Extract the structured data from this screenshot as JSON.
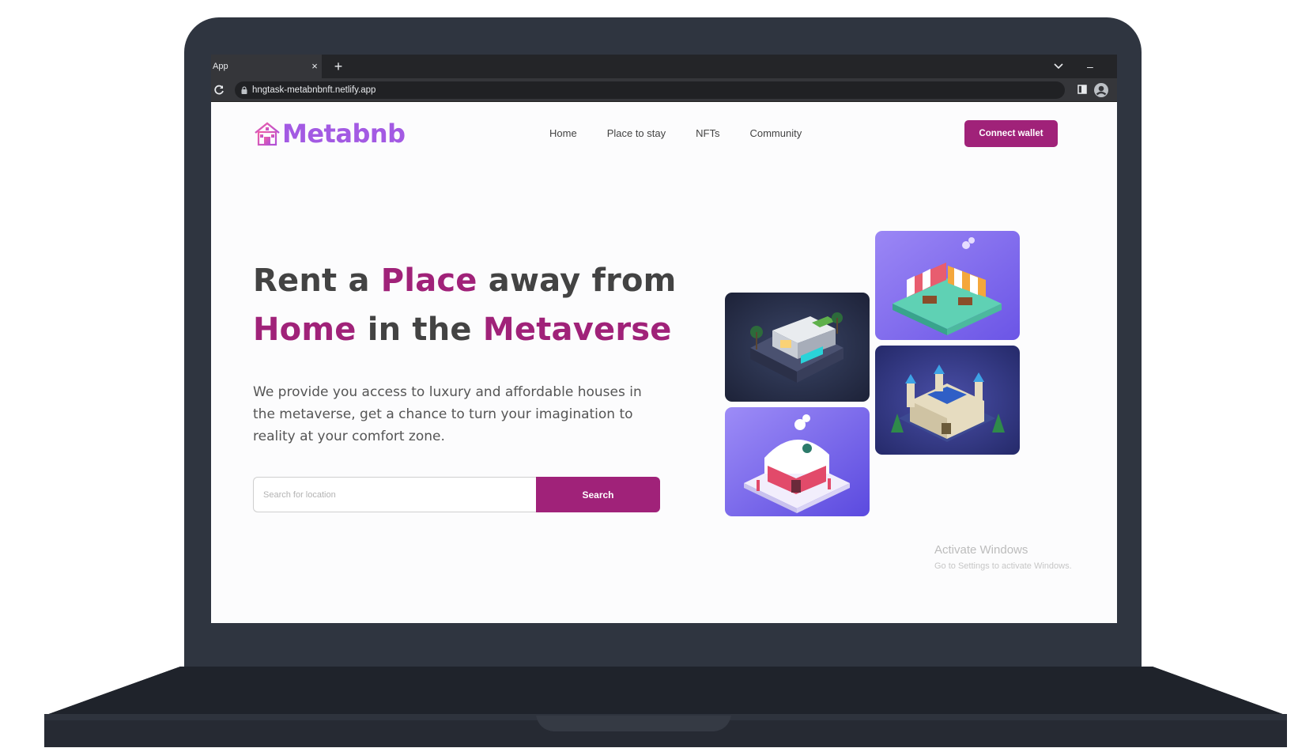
{
  "browser": {
    "tab_title": "App",
    "tab_close": "×",
    "new_tab": "+",
    "minimize": "–",
    "url": "hngtask-metabnbnft.netlify.app"
  },
  "header": {
    "logo_text": "Metabnb",
    "nav": [
      "Home",
      "Place to stay",
      "NFTs",
      "Community"
    ],
    "connect_label": "Connect wallet"
  },
  "hero": {
    "title_parts": [
      "Rent a ",
      "Place",
      " away from ",
      "Home",
      " in the ",
      "Metaverse"
    ],
    "description": "We provide you access to luxury and affordable houses in the metaverse, get a chance to turn your imagination to reality at your comfort zone.",
    "search_placeholder": "Search for location",
    "search_label": "Search"
  },
  "tiles": [
    "modern-villa-image",
    "market-stall-image",
    "snow-cottage-image",
    "castle-image"
  ],
  "watermark": {
    "title": "Activate Windows",
    "subtitle": "Go to Settings to activate Windows."
  },
  "colors": {
    "accent": "#a02279",
    "logo": "#a35ae3",
    "text": "#434343",
    "laptop": "#2f3540"
  }
}
